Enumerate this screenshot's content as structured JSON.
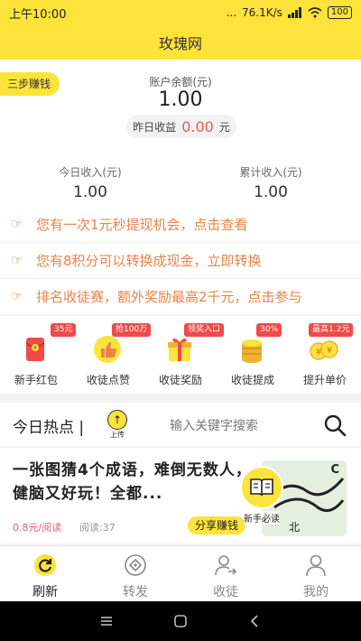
{
  "status_bar": {
    "time": "上午10:00",
    "signal": "...",
    "speed": "76.1K/s",
    "battery": "100"
  },
  "header": {
    "title": "玫瑰网"
  },
  "account": {
    "three_steps": "三步赚钱",
    "balance_label": "账户余额(元)",
    "balance_value": "1.00",
    "yesterday_label": "昨日收益",
    "yesterday_value": "0.00",
    "yesterday_unit": "元",
    "today_label": "今日收入(元)",
    "today_value": "1.00",
    "total_label": "累计收入(元)",
    "total_value": "1.00"
  },
  "notices": [
    {
      "text": "您有一次1元秒提现机会，点击查看"
    },
    {
      "text": "您有8积分可以转换成现金，立即转换"
    },
    {
      "text": "排名收徒赛，额外奖励最高2千元，点击参与"
    }
  ],
  "actions": [
    {
      "badge": "35元",
      "label": "新手红包",
      "icon": "red-envelope-icon"
    },
    {
      "badge": "抢100万",
      "label": "收徒点赞",
      "icon": "thumbs-up-icon"
    },
    {
      "badge": "领奖入口",
      "label": "收徒奖励",
      "icon": "gift-box-icon"
    },
    {
      "badge": "30%",
      "label": "收徒提成",
      "icon": "coin-stack-icon"
    },
    {
      "badge": "最高1.2元",
      "label": "提升单价",
      "icon": "yen-coins-icon"
    }
  ],
  "hot": {
    "title": "今日热点 |",
    "upload_label": "上传",
    "search_placeholder": "输入关键字搜索"
  },
  "article": {
    "title": "一张图猜4个成语，难倒无数人，健脑又好玩！全都...",
    "price": "0.8元/阅读",
    "reads": "阅读:37",
    "share_label": "分享赚钱",
    "thumb_text": "新手必读"
  },
  "tabs": [
    {
      "label": "刷新",
      "icon": "refresh-icon",
      "active": true
    },
    {
      "label": "转发",
      "icon": "share-icon",
      "active": false
    },
    {
      "label": "收徒",
      "icon": "add-friend-icon",
      "active": false
    },
    {
      "label": "我的",
      "icon": "user-icon",
      "active": false
    }
  ],
  "colors": {
    "brand_yellow": "#fde33a",
    "notice_orange": "#e8834a",
    "badge_red": "#f04a4a",
    "value_red": "#f05a5a"
  }
}
